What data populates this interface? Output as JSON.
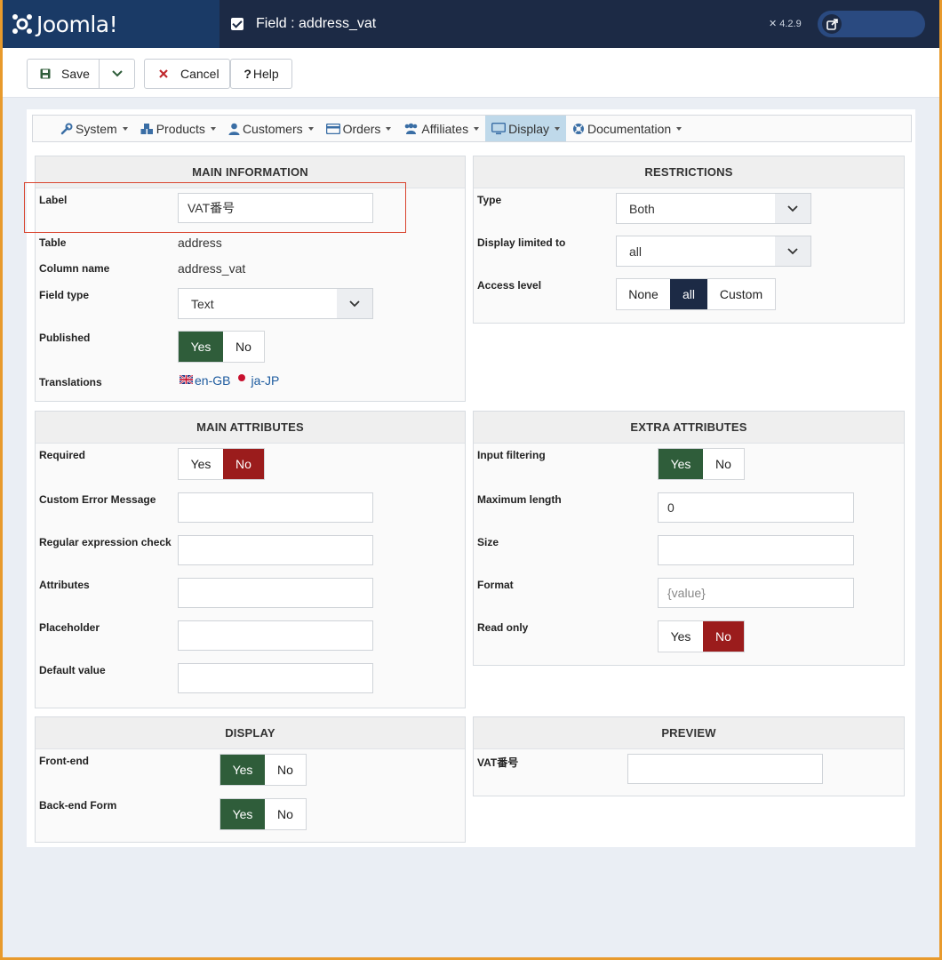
{
  "header": {
    "brand": "Joomla!",
    "page_title": "Field : address_vat",
    "version": "4.2.9"
  },
  "toolbar": {
    "save_label": "Save",
    "cancel_label": "Cancel",
    "help_label": "Help"
  },
  "menu": {
    "items": [
      {
        "label": "System"
      },
      {
        "label": "Products"
      },
      {
        "label": "Customers"
      },
      {
        "label": "Orders"
      },
      {
        "label": "Affiliates"
      },
      {
        "label": "Display"
      },
      {
        "label": "Documentation"
      }
    ]
  },
  "main_info": {
    "title": "MAIN INFORMATION",
    "label_label": "Label",
    "label_value": "VAT番号",
    "table_label": "Table",
    "table_value": "address",
    "column_label": "Column name",
    "column_value": "address_vat",
    "field_type_label": "Field type",
    "field_type_value": "Text",
    "published_label": "Published",
    "published_yes": "Yes",
    "published_no": "No",
    "translations_label": "Translations",
    "translation_en": "en-GB",
    "translation_ja": "ja-JP"
  },
  "restrictions": {
    "title": "RESTRICTIONS",
    "type_label": "Type",
    "type_value": "Both",
    "display_label": "Display limited to",
    "display_value": "all",
    "access_label": "Access level",
    "access_none": "None",
    "access_all": "all",
    "access_custom": "Custom"
  },
  "main_attr": {
    "title": "MAIN ATTRIBUTES",
    "required_label": "Required",
    "required_yes": "Yes",
    "required_no": "No",
    "error_label": "Custom Error Message",
    "regex_label": "Regular expression check",
    "attributes_label": "Attributes",
    "placeholder_label": "Placeholder",
    "default_label": "Default value"
  },
  "extra_attr": {
    "title": "EXTRA ATTRIBUTES",
    "filter_label": "Input filtering",
    "filter_yes": "Yes",
    "filter_no": "No",
    "maxlen_label": "Maximum length",
    "maxlen_value": "0",
    "size_label": "Size",
    "format_label": "Format",
    "format_placeholder": "{value}",
    "readonly_label": "Read only",
    "readonly_yes": "Yes",
    "readonly_no": "No"
  },
  "display": {
    "title": "DISPLAY",
    "front_label": "Front-end",
    "front_yes": "Yes",
    "front_no": "No",
    "back_label": "Back-end Form",
    "back_yes": "Yes",
    "back_no": "No"
  },
  "preview": {
    "title": "PREVIEW",
    "field_label": "VAT番号"
  }
}
